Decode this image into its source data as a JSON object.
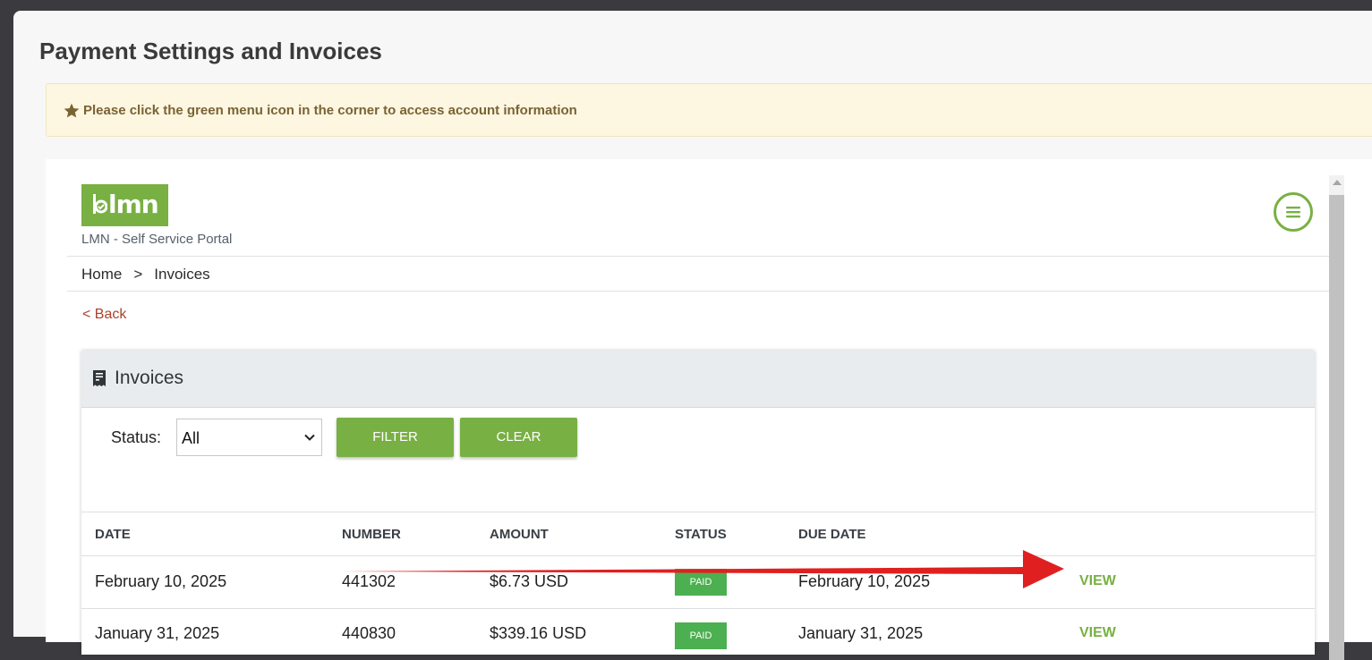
{
  "page_title": "Payment Settings and Invoices",
  "notice": {
    "text": "Please click the green menu icon in the corner to access account information",
    "icon": "star-icon"
  },
  "portal": {
    "logo_text": "lmn",
    "name": "LMN - Self Service Portal",
    "menu_icon": "hamburger-circle-icon",
    "breadcrumb": {
      "home": "Home",
      "separator": ">",
      "current": "Invoices"
    },
    "back_label": "< Back"
  },
  "invoices_card": {
    "title": "Invoices",
    "icon": "receipt-icon",
    "filter": {
      "status_label": "Status:",
      "status_selected": "All",
      "filter_button": "FILTER",
      "clear_button": "CLEAR"
    },
    "columns": [
      "DATE",
      "NUMBER",
      "AMOUNT",
      "STATUS",
      "DUE DATE"
    ],
    "rows": [
      {
        "date": "February 10, 2025",
        "number": "441302",
        "amount": "$6.73 USD",
        "status": "PAID",
        "due_date": "February 10, 2025",
        "action": "VIEW"
      },
      {
        "date": "January 31, 2025",
        "number": "440830",
        "amount": "$339.16 USD",
        "status": "PAID",
        "due_date": "January 31, 2025",
        "action": "VIEW"
      }
    ]
  },
  "colors": {
    "accent_green": "#78b043",
    "badge_green": "#4caf50",
    "annotation_red": "#e02020"
  }
}
